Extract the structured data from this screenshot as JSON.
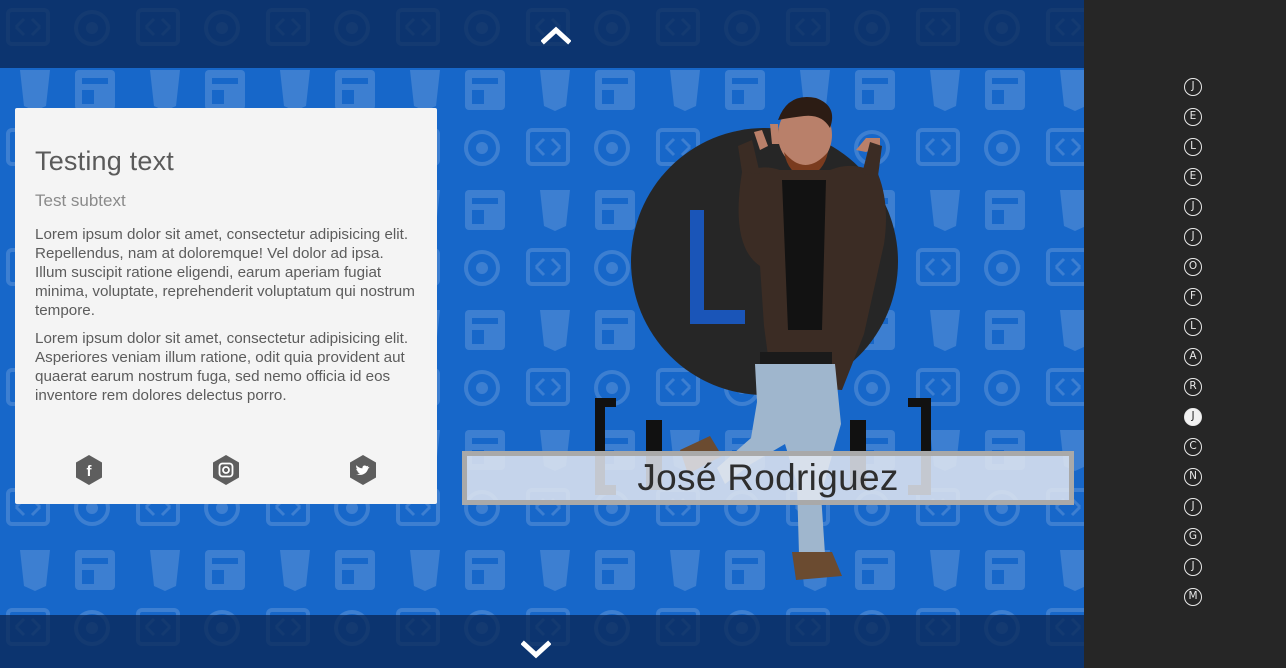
{
  "card": {
    "title": "Testing text",
    "subtitle": "Test subtext",
    "paragraphs": [
      "Lorem ipsum dolor sit amet, consectetur adipisicing elit. Repellendus, nam at doloremque! Vel dolor ad ipsa. Illum suscipit ratione eligendi, earum aperiam fugiat minima, voluptate, reprehenderit voluptatum qui nostrum tempore.",
      "Lorem ipsum dolor sit amet, consectetur adipisicing elit. Asperiores veniam illum ratione, odit quia provident aut quaerat earum nostrum fuga, sed nemo officia id eos inventore rem dolores delectus porro."
    ],
    "socials": [
      {
        "icon": "facebook-icon",
        "glyph": "f"
      },
      {
        "icon": "instagram-icon",
        "glyph": "◎"
      },
      {
        "icon": "twitter-icon",
        "glyph": "✦"
      }
    ]
  },
  "hero": {
    "name": "José Rodriguez"
  },
  "nav": {
    "up_icon": "chevron-up-icon",
    "down_icon": "chevron-down-icon",
    "letters": [
      "J",
      "E",
      "L",
      "E",
      "J",
      "J",
      "O",
      "F",
      "L",
      "A",
      "R",
      "J",
      "C",
      "N",
      "J",
      "G",
      "J",
      "M"
    ],
    "active_index": 11
  },
  "colors": {
    "stage_blue": "#1767c9",
    "bar_dark": "#0a2656",
    "card_bg": "#f4f4f4",
    "sidebar_bg": "#262626",
    "hex_icon": "#5e5e5e"
  }
}
